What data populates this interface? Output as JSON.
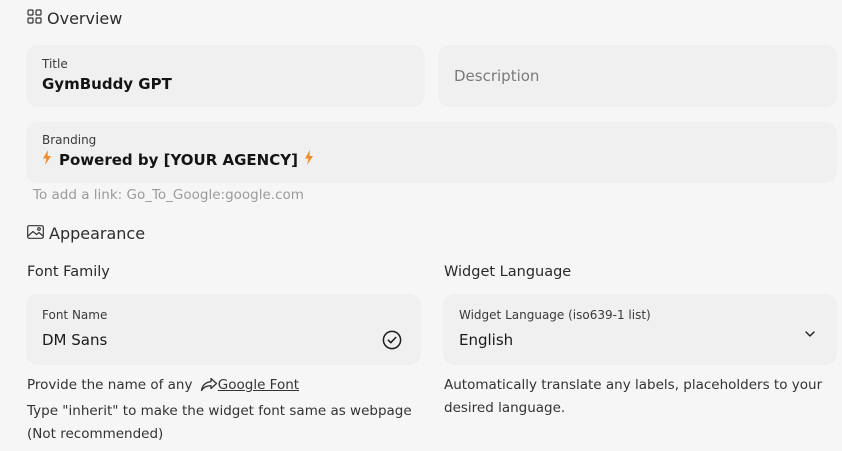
{
  "overview": {
    "heading": "Overview"
  },
  "title_field": {
    "label": "Title",
    "value": "GymBuddy GPT"
  },
  "description_field": {
    "placeholder": "Description"
  },
  "branding_field": {
    "label": "Branding",
    "value": "Powered by [YOUR AGENCY]"
  },
  "branding_hint": "To add a link: Go_To_Google:google.com",
  "appearance": {
    "heading": "Appearance"
  },
  "font_family": {
    "label": "Font Family",
    "field_label": "Font Name",
    "value": "DM Sans",
    "help_prefix": "Provide the name of any",
    "help_link": "Google Font",
    "help_line2": "Type \"inherit\" to make the widget font same as webpage",
    "help_line3": "(Not recommended)"
  },
  "widget_language": {
    "label": "Widget Language",
    "field_label": "Widget Language (iso639-1 list)",
    "value": "English",
    "help_line1": "Automatically translate any labels, placeholders to your",
    "help_line2": "desired language."
  },
  "colors": {
    "accent": "#f08a2b",
    "card": "#f1f0f0",
    "background": "#f7f6f6"
  }
}
